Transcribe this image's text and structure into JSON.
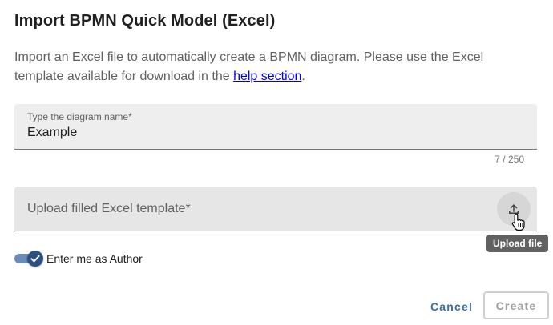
{
  "dialog": {
    "title": "Import BPMN Quick Model (Excel)",
    "description_before_link": "Import an Excel file to automatically create a BPMN diagram. Please use the Excel template available for download in the ",
    "help_link_label": "help section",
    "description_after_link": "."
  },
  "name_field": {
    "label": "Type the diagram name*",
    "value": "Example",
    "counter": "7 / 250"
  },
  "upload_field": {
    "placeholder": "Upload filled Excel template*",
    "button_icon": "upload-icon",
    "tooltip": "Upload file"
  },
  "author_toggle": {
    "label": "Enter me as Author",
    "checked": true,
    "icon": "check-icon"
  },
  "actions": {
    "cancel_label": "Cancel",
    "create_label": "Create"
  },
  "colors": {
    "accent": "#2d5082",
    "link": "#0000ee",
    "tooltip_bg": "#616161"
  }
}
